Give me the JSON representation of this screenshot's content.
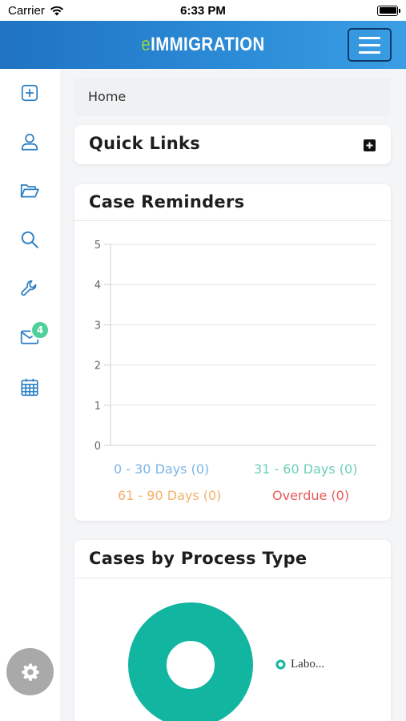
{
  "status_bar": {
    "carrier": "Carrier",
    "time": "6:33 PM"
  },
  "header": {
    "logo_prefix": "e",
    "logo_main": "IMMIGRATION"
  },
  "sidebar": {
    "items": [
      {
        "icon": "plus-square-icon"
      },
      {
        "icon": "user-icon"
      },
      {
        "icon": "folder-open-icon"
      },
      {
        "icon": "search-icon"
      },
      {
        "icon": "wrench-icon"
      },
      {
        "icon": "mail-icon",
        "badge": "4"
      },
      {
        "icon": "calendar-icon"
      }
    ],
    "settings_icon": "gear-icon"
  },
  "breadcrumb": {
    "home": "Home"
  },
  "quick_links": {
    "title": "Quick Links",
    "add_icon": "plus-icon"
  },
  "case_reminders": {
    "title": "Case Reminders"
  },
  "cases_by_process": {
    "title": "Cases by Process Type",
    "legend_label": "Labo..."
  },
  "colors": {
    "accent": "#2b8ad6",
    "range_0_30": "#7cb5e6",
    "range_31_60": "#6ccfb7",
    "range_61_90": "#f5b26b",
    "overdue": "#e95b5b",
    "donut": "#12b5a0"
  },
  "chart_data": [
    {
      "type": "bar",
      "title": "Case Reminders",
      "ylim": [
        0,
        5
      ],
      "yticks": [
        "0",
        "1",
        "2",
        "3",
        "4",
        "5"
      ],
      "grid": true,
      "legend_position": "bottom",
      "series": [
        {
          "name": "0 - 30 Days (0)",
          "values": [
            0
          ]
        },
        {
          "name": "31 - 60 Days (0)",
          "values": [
            0
          ]
        },
        {
          "name": "61 - 90 Days (0)",
          "values": [
            0
          ]
        },
        {
          "name": "Overdue (0)",
          "values": [
            0
          ]
        }
      ]
    },
    {
      "type": "pie",
      "title": "Cases by Process Type",
      "legend_position": "right",
      "categories": [
        "Labo..."
      ],
      "values": [
        1
      ]
    }
  ]
}
